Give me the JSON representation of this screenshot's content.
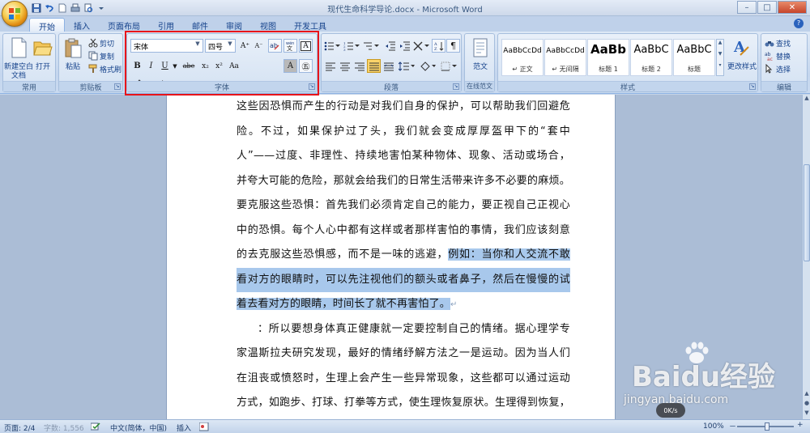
{
  "window": {
    "title": "现代生命科学导论.docx - Microsoft Word",
    "controls": {
      "minimize": "–",
      "maximize": "□",
      "close": "✕"
    }
  },
  "quick_access": [
    "save-icon",
    "undo-icon",
    "redo-icon",
    "new-doc-icon",
    "print-icon",
    "customize-icon"
  ],
  "tabs": [
    {
      "label": "开始",
      "active": true
    },
    {
      "label": "插入"
    },
    {
      "label": "页面布局"
    },
    {
      "label": "引用"
    },
    {
      "label": "邮件"
    },
    {
      "label": "审阅"
    },
    {
      "label": "视图"
    },
    {
      "label": "开发工具"
    }
  ],
  "ribbon": {
    "common": {
      "title": "常用",
      "new_label": "新建空白文档",
      "open_label": "打开"
    },
    "clipboard": {
      "title": "剪贴板",
      "paste_label": "粘贴",
      "cut_label": "剪切",
      "copy_label": "复制",
      "format_painter_label": "格式刷"
    },
    "font": {
      "title": "字体",
      "font_name": "宋体",
      "font_size": "四号",
      "grow": "A⁺",
      "shrink": "A⁻",
      "bold": "B",
      "italic": "I",
      "underline": "U",
      "strikethrough": "abe",
      "subscript": "x₂",
      "superscript": "x²",
      "change_case": "Aa",
      "font_color": "A",
      "char_shading": "A",
      "enclose": "㊄",
      "highlight_color": "#ffff00",
      "font_color_hex": "#ff0000"
    },
    "paragraph": {
      "title": "段落"
    },
    "online_paragraph": {
      "title": "在线范文",
      "label": "范文"
    },
    "styles": {
      "title": "样式",
      "tiles": [
        {
          "sample": "AaBbCcDd",
          "name": "↵ 正文"
        },
        {
          "sample": "AaBbCcDd",
          "name": "↵ 无间隔"
        },
        {
          "sample": "AaBb",
          "name": "标题 1"
        },
        {
          "sample": "AaBbC",
          "name": "标题 2"
        },
        {
          "sample": "AaBbC",
          "name": "标题"
        }
      ],
      "change_styles_label": "更改样式"
    },
    "editing": {
      "title": "编辑",
      "find_label": "查找",
      "replace_label": "替换",
      "select_label": "选择"
    }
  },
  "document": {
    "lines": [
      {
        "text": "这些因恐惧而产生的行动是对我们自身的保护，可以帮助我们回避危"
      },
      {
        "text": "险。不过，如果保护过了头，我们就会变成厚厚盔甲下的“套中"
      },
      {
        "text": "人”——过度、非理性、持续地害怕某种物体、现象、活动或场合，"
      },
      {
        "text": "并夸大可能的危险，那就会给我们的日常生活带来许多不必要的麻烦。"
      },
      {
        "text": "要克服这些恐惧：首先我们必须肯定自己的能力，要正视自己正视心"
      },
      {
        "text": "中的恐惧。每个人心中都有这样或者那样害怕的事情，我们应该刻意"
      },
      {
        "pre": "的去克服这些恐惧感，而不是一味的逃避，",
        "sel": "例如：当你和人交流不敢"
      },
      {
        "sel": "看对方的眼睛时，可以先注视他们的额头或者鼻子，然后在慢慢的试"
      },
      {
        "sel": "着去看对方的眼睛，时间长了就不再害怕了。",
        "mark": "↵"
      },
      {
        "text": "：所以要想身体真正健康就一定要控制自己的情绪。据心理学专"
      },
      {
        "text": "家温斯拉夫研究发现，最好的情绪纾解方法之一是运动。因为当人们"
      },
      {
        "text": "在沮丧或愤怒时，生理上会产生一些异常现象，这些都可以通过运动"
      },
      {
        "text": "方式，如跑步、打球、打拳等方式，使生理恢复原状。生理得到恢复，"
      }
    ]
  },
  "status": {
    "page": "页面: 2/4",
    "words": "字数: 1,556",
    "language": "中文(简体，中国)",
    "mode": "插入",
    "zoom": "100%",
    "zoom_out": "－",
    "zoom_in": "+"
  },
  "watermark": {
    "brand": "Baidu经验",
    "url": "jingyan.baidu.com",
    "speed": "0K/s"
  },
  "colors": {
    "selection": "#a8c8ec",
    "highlight_frame": "#e8141a"
  }
}
